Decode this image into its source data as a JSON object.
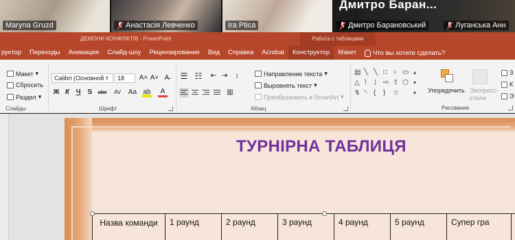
{
  "zoom": {
    "participants": [
      {
        "name": "Maryna Gruzd",
        "muted": false
      },
      {
        "name": "Анастасія Левченко",
        "muted": true
      },
      {
        "name": "Ira Ptica",
        "muted": false,
        "active": true
      },
      {
        "name": "Дмитро Барановський",
        "muted": true
      },
      {
        "name": "Луганська Анн",
        "muted": true
      }
    ],
    "speaker_caption": "Дмитро Баран..."
  },
  "titlebar": {
    "document": "ДЕМОНИ КОНФЛІКТІВ  -  PowerPoint",
    "context_tab": "Работа с таблицами"
  },
  "ribbon_tabs": [
    "руктор",
    "Переходы",
    "Анимация",
    "Слайд-шоу",
    "Рецензирование",
    "Вид",
    "Справка",
    "Acrobat",
    "Конструктор",
    "Макет"
  ],
  "tell_me": "Что вы хотите сделать?",
  "ribbon": {
    "slides": {
      "layout": "Макет",
      "reset": "Сбросить",
      "section": "Раздел",
      "label": "Слайды"
    },
    "font": {
      "name": "Calibri (Основной т",
      "size": "18",
      "bold": "Ж",
      "italic": "К",
      "underline": "Ч",
      "strike": "S",
      "abc": "abc",
      "spacing": "AV",
      "case": "Aa",
      "label": "Шрифт"
    },
    "paragraph": {
      "text_direction": "Направление текста",
      "align_text": "Выровнять текст",
      "smartart": "Преобразовать в SmartArt",
      "label": "Абзац"
    },
    "drawing": {
      "arrange": "Упорядочить",
      "quick_styles": "Экспресс-стили",
      "label": "Рисование"
    }
  },
  "slide": {
    "title": "ТУРНІРНА ТАБЛИЦЯ",
    "table_headers": [
      "Назва команди",
      "1 раунд",
      "2 раунд",
      "3 раунд",
      "4 раунд",
      "5 раунд",
      "Супер гра"
    ]
  },
  "colors": {
    "ppt_accent": "#b7472a",
    "title_purple": "#7030a0",
    "active_speaker": "#33d05a",
    "mute_red": "#e23c3c"
  }
}
